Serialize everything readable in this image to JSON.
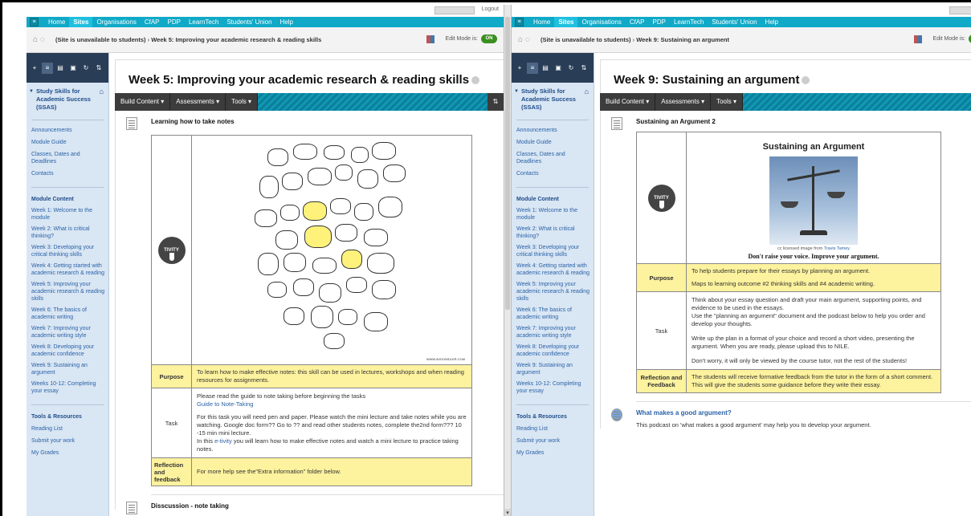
{
  "global_nav": [
    "Home",
    "Sites",
    "Organisations",
    "CfAP",
    "PDP",
    "LearnTech",
    "Students' Union",
    "Help"
  ],
  "logout": "Logout",
  "edit_mode": {
    "label": "Edit Mode is:",
    "state": "ON"
  },
  "left": {
    "breadcrumb_course": "(Site is unavailable to students)",
    "breadcrumb_page": "Week 5: Improving your academic research & reading skills",
    "page_title": "Week 5: Improving your academic research & reading skills",
    "item1": {
      "title": "Learning how to take notes",
      "purpose_label": "Purpose",
      "purpose_text": "To learn how to make effective notes: this skill can be used in lectures, workshops and when reading resources for assignments.",
      "task_label": "Task",
      "task_line1": "Please read the guide to note taking before beginning the tasks",
      "task_link": "Guide to Note-Taking",
      "task_line2": "For this task you will need pen and paper. Please watch the mini lecture and take notes while you are watching. Google doc form?? Go to ?? and read other students notes, complete the2nd form??? 10 -15 min mini lecture.",
      "task_line3_pre": "In this ",
      "task_line3_link": "e-tivity",
      "task_line3_post": " you will learn how to make effective notes and watch a mini lecture to practice taking notes.",
      "reflection_label": "Reflection and feedback",
      "reflection_text": "For more help see the\"Extra information\" folder below.",
      "sketch_credit": "WWW.AVDOWDLER.COM"
    },
    "item2": {
      "title": "Disscussion - note taking"
    }
  },
  "right": {
    "breadcrumb_course": "(Site is unavailable to students)",
    "breadcrumb_page": "Week 9: Sustaining an argument",
    "page_title": "Week 9: Sustaining an argument",
    "item1": {
      "title": "Sustaining an Argument 2",
      "heading": "Sustaining an Argument",
      "caption_pre": "cc licensed image from ",
      "caption_link": "Travis Tamey",
      "slogan": "Don't raise your voice. Improve your argument.",
      "purpose_label": "Purpose",
      "purpose_text1": "To help students prepare for their essays by planning an argument.",
      "purpose_text2": "Maps to learning outcome #2 thinking skills and #4 academic writing.",
      "task_label": "Task",
      "task_p1": "Think about your essay question and draft your main argument, supporting points, and evidence to be used in the essays.",
      "task_p2": "Use the \"planning an argument\" document and the podcast below to help you order and develop your thoughts.",
      "task_p3": "Write up the plan in a format of your choice and record a short video, presenting the argument. When you are ready, please upload this to NILE.",
      "task_p4": "Don't worry, it will only be viewed by the course tutor, not the rest of the students!",
      "reflection_label": "Reflection and Feedback",
      "reflection_text": "The students will receive formative feedback from the tutor in the form of a short comment. This will give the students some guidance before they write their essay."
    },
    "item2": {
      "title": "What makes a good argument?",
      "desc": "This podcast on 'what makes a good argument' may help you to develop your argument."
    }
  },
  "course": {
    "title": "Study Skills for Academic Success (SSAS)"
  },
  "sidebar_links_top": [
    "Announcements",
    "Module Guide",
    "Classes, Dates and Deadlines",
    "Contacts"
  ],
  "sidebar_head_module": "Module Content",
  "sidebar_weeks": [
    "Week 1: Welcome to the module",
    "Week 2: What is critical thinking?",
    "Week 3: Developing your critical thinking skills",
    "Week 4: Getting started with academic research & reading",
    "Week 5: Improving your academic research & reading skills",
    "Week 6: The basics of academic writing",
    "Week 7: Improving your academic writing style",
    "Week 8: Developing your academic confidence",
    "Week 9: Sustaining an argument",
    "Weeks 10-12: Completing your essay"
  ],
  "sidebar_head_tools": "Tools & Resources",
  "sidebar_tools": [
    "Reading List",
    "Submit your work",
    "My Grades"
  ],
  "action_bar": {
    "build": "Build Content",
    "assess": "Assessments",
    "tools": "Tools"
  },
  "tivity_label": "TIVITY"
}
